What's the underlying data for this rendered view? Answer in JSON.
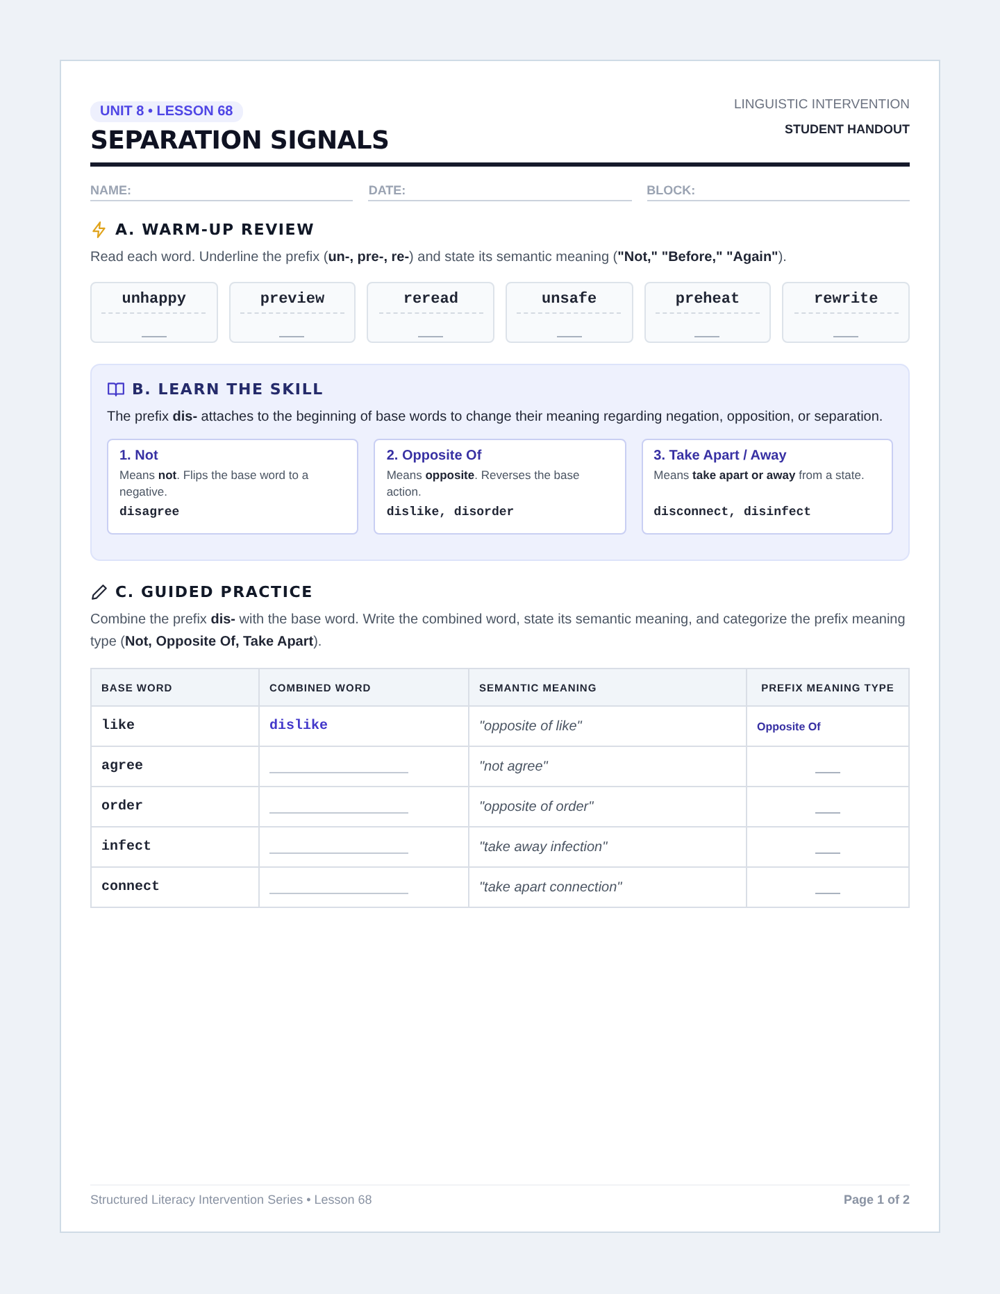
{
  "header": {
    "badge": "UNIT 8 • LESSON 68",
    "title": "SEPARATION SIGNALS",
    "program": "LINGUISTIC INTERVENTION",
    "doc_type": "STUDENT HANDOUT"
  },
  "fields": [
    {
      "label": "NAME:"
    },
    {
      "label": "DATE:"
    },
    {
      "label": "BLOCK:"
    }
  ],
  "warmup": {
    "heading": "A. WARM-UP REVIEW",
    "instructions": "Read each word. Underline the prefix (**un-, pre-, re-**) and state its semantic meaning (**\"Not,\" \"Before,\" \"Again\"**).",
    "words": [
      "unhappy",
      "preview",
      "reread",
      "unsafe",
      "preheat",
      "rewrite"
    ]
  },
  "learn": {
    "heading": "B. LEARN THE SKILL",
    "text": "The prefix **dis-** attaches to the beginning of base words to change their meaning regarding negation, opposition, or separation.",
    "meanings": [
      {
        "title": "1. Not",
        "description": "Means **not**. Flips the base word to a negative.",
        "examples": "disagree"
      },
      {
        "title": "2. Opposite Of",
        "description": "Means **opposite**. Reverses the base action.",
        "examples": "dislike, disorder"
      },
      {
        "title": "3. Take Apart / Away",
        "description": "Means **take apart or away** from a state.",
        "examples": "disconnect, disinfect"
      }
    ]
  },
  "practice": {
    "heading": "C. GUIDED PRACTICE",
    "instructions": "Combine the prefix **dis-** with the base word. Write the combined word, state its semantic meaning, and categorize the prefix meaning type (**Not, Opposite Of, Take Apart**).",
    "table": {
      "columns": [
        "BASE WORD",
        "COMBINED WORD",
        "SEMANTIC MEANING",
        "PREFIX MEANING TYPE"
      ],
      "rows": [
        {
          "base": "like",
          "combined": "dislike",
          "meaning": "\"opposite of like\"",
          "type": "Opposite Of"
        },
        {
          "base": "agree",
          "meaning": "\"not agree\""
        },
        {
          "base": "order",
          "meaning": "\"opposite of order\""
        },
        {
          "base": "infect",
          "meaning": "\"take away infection\""
        },
        {
          "base": "connect",
          "meaning": "\"take apart connection\""
        }
      ]
    }
  },
  "footer": {
    "series": "Structured Literacy Intervention Series • Lesson 68",
    "page": "Page 1 of 2"
  }
}
